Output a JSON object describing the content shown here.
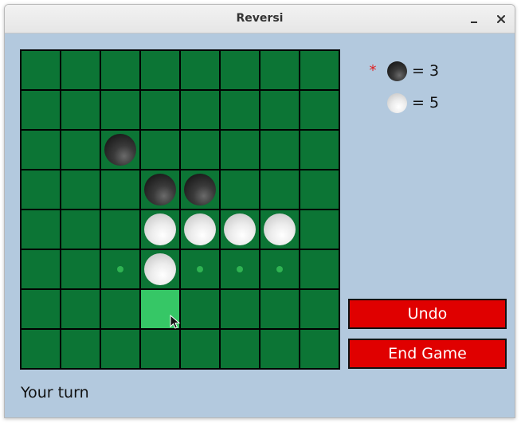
{
  "window": {
    "title": "Reversi"
  },
  "board": {
    "rows": [
      [
        "",
        "",
        "",
        "",
        "",
        "",
        "",
        ""
      ],
      [
        "",
        "",
        "",
        "",
        "",
        "",
        "",
        ""
      ],
      [
        "",
        "",
        "B",
        "",
        "",
        "",
        "",
        ""
      ],
      [
        "",
        "",
        "",
        "B",
        "B",
        "",
        "",
        ""
      ],
      [
        "",
        "",
        "",
        "W",
        "W",
        "W",
        "W",
        ""
      ],
      [
        "",
        "",
        ".",
        "W",
        ".",
        ".",
        ".",
        ""
      ],
      [
        "",
        "",
        "",
        "H",
        "",
        "",
        "",
        ""
      ],
      [
        "",
        "",
        "",
        "",
        "",
        "",
        "",
        ""
      ]
    ],
    "legend": {
      "B": "black disc",
      "W": "white disc",
      ".": "valid move hint",
      "H": "hovered cell"
    }
  },
  "scores": {
    "black": {
      "value": "= 3",
      "turn_marker": "*"
    },
    "white": {
      "value": "= 5"
    }
  },
  "buttons": {
    "undo": "Undo",
    "end_game": "End Game"
  },
  "status": "Your turn",
  "colors": {
    "board": "#0c7535",
    "grid_lines": "#000000",
    "hover_cell": "#36c766",
    "hint_dot": "#2fb352",
    "button_bg": "#e00000",
    "panel_bg": "#b3c9de",
    "turn_marker": "#e02020"
  }
}
